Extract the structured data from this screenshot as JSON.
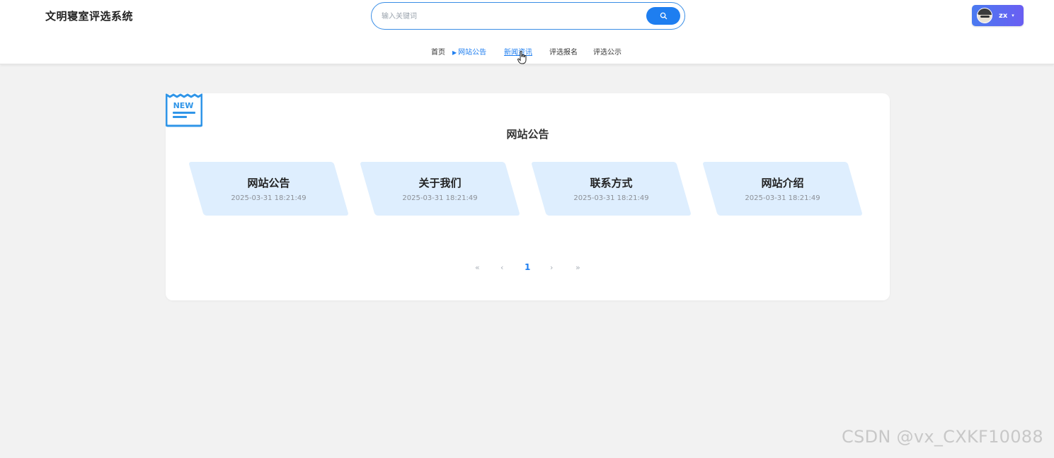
{
  "header": {
    "site_title": "文明寝室评选系统",
    "search": {
      "placeholder": "输入关键词"
    },
    "user": {
      "name": "zx",
      "caret": "▾"
    }
  },
  "nav": {
    "items": [
      {
        "label": "首页"
      },
      {
        "label": "网站公告",
        "marker": "▶"
      },
      {
        "label": "新闻资讯"
      },
      {
        "label": "评选报名"
      },
      {
        "label": "评选公示"
      }
    ]
  },
  "section": {
    "badge": "NEW",
    "title": "网站公告",
    "items": [
      {
        "title": "网站公告",
        "date": "2025-03-31 18:21:49"
      },
      {
        "title": "关于我们",
        "date": "2025-03-31 18:21:49"
      },
      {
        "title": "联系方式",
        "date": "2025-03-31 18:21:49"
      },
      {
        "title": "网站介绍",
        "date": "2025-03-31 18:21:49"
      }
    ]
  },
  "pagination": {
    "first": "«",
    "prev": "‹",
    "current": "1",
    "next": "›",
    "last": "»"
  },
  "watermark": "CSDN @vx_CXKF10088",
  "colors": {
    "accent": "#1e7ef0",
    "card_item_bg": "#deeefe",
    "page_bg": "#f2f2f2"
  }
}
